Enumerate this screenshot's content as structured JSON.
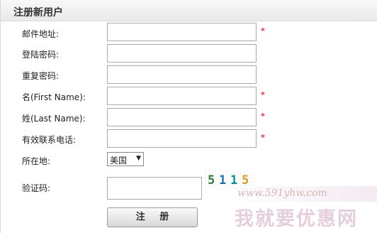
{
  "header": {
    "title": "注册新用户"
  },
  "fields": [
    {
      "label": "邮件地址:",
      "value": "",
      "required_mark": "*"
    },
    {
      "label": "登陆密码:",
      "value": "",
      "required_mark": ""
    },
    {
      "label": "重复密码:",
      "value": "",
      "required_mark": ""
    },
    {
      "label": "名(First Name):",
      "value": "",
      "required_mark": "*"
    },
    {
      "label": "姓(Last Name):",
      "value": "",
      "required_mark": "*"
    },
    {
      "label": "有效联系电话:",
      "value": "",
      "required_mark": "*"
    }
  ],
  "location": {
    "label": "所在地:",
    "selected": "美国"
  },
  "captcha": {
    "label": "验证码:",
    "value": "",
    "digits": [
      "5",
      "1",
      "1",
      "5"
    ],
    "digit_colors": [
      "#2e7d32",
      "#1f6fb0",
      "#0a8f8f",
      "#d89a20"
    ]
  },
  "submit": {
    "label": "注 册"
  },
  "watermark": {
    "url": "www.591yhw.com",
    "text": "我就要优惠网"
  },
  "colors": {
    "required": "#e03030",
    "header_bg": "#eeeeee"
  }
}
